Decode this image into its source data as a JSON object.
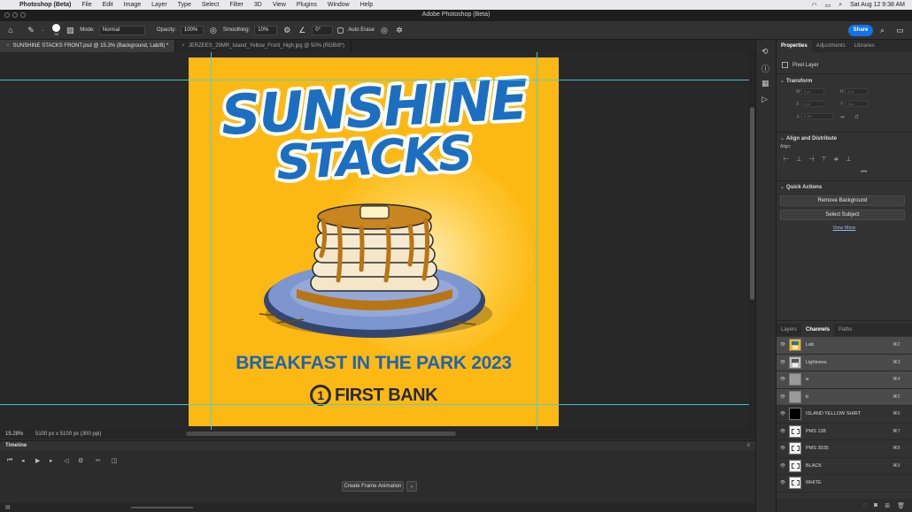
{
  "menubar": {
    "app": "Photoshop (Beta)",
    "items": [
      "File",
      "Edit",
      "Image",
      "Layer",
      "Type",
      "Select",
      "Filter",
      "3D",
      "View",
      "Plugins",
      "Window",
      "Help"
    ],
    "clock": "Sat Aug 12  9:38 AM"
  },
  "titlebar": {
    "title": "Adobe Photoshop (Beta)"
  },
  "options": {
    "brush_size": "90",
    "mode_label": "Mode:",
    "mode_value": "Normal",
    "opacity_label": "Opacity:",
    "opacity_value": "100%",
    "smoothing_label": "Smoothing:",
    "smoothing_value": "10%",
    "angle_value": "0°",
    "auto_erase": "Auto Erase",
    "share": "Share"
  },
  "tabs": [
    {
      "label": "SUNSHINE STACKS FRONT.psd @ 15.3% (Background, Lab/8) *"
    },
    {
      "label": "JERZEES_29MR_Island_Yellow_Front_High.jpg @ 50% (RGB/8*)"
    }
  ],
  "artwork": {
    "title_line1": "SUNSHINE",
    "title_line2": "STACKS",
    "subtitle": "BREAKFAST IN THE PARK 2023",
    "sponsor_num": "1",
    "sponsor": "FIRST BANK",
    "colors": {
      "background": "#fdb913",
      "title": "#1c6fc0",
      "plate": "#6e88c4",
      "syrup": "#b87514"
    }
  },
  "status": {
    "zoom": "15.28%",
    "dimensions": "5100 px x 5100 px (300 ppi)"
  },
  "timeline": {
    "header": "Timeline",
    "create_button": "Create Frame Animation"
  },
  "properties": {
    "tabs": [
      "Properties",
      "Adjustments",
      "Libraries"
    ],
    "layer_type": "Pixel Layer",
    "transform_header": "Transform",
    "w_label": "W",
    "h_label": "H",
    "x_label": "X",
    "y_label": "Y",
    "w_val": "0 px",
    "h_val": "0 px",
    "x_val": "0 px",
    "y_val": "0 px",
    "angle_val": "0.00°",
    "align_header": "Align and Distribute",
    "align_label": "Align:",
    "quick_header": "Quick Actions",
    "remove_bg": "Remove Background",
    "select_subject": "Select Subject",
    "view_more": "View More"
  },
  "channels_panel": {
    "tabs": [
      "Layers",
      "Channels",
      "Paths"
    ],
    "rows": [
      {
        "name": "Lab",
        "shortcut": "⌘2",
        "selected": true,
        "thumb": "color"
      },
      {
        "name": "Lightness",
        "shortcut": "⌘3",
        "selected": true,
        "thumb": "gray"
      },
      {
        "name": "a",
        "shortcut": "⌘4",
        "selected": true,
        "thumb": "flat"
      },
      {
        "name": "b",
        "shortcut": "⌘5",
        "selected": true,
        "thumb": "flat"
      },
      {
        "name": "ISLAND YELLOW SHIRT",
        "shortcut": "⌘6",
        "selected": false,
        "thumb": "black"
      },
      {
        "name": "PMS 138",
        "shortcut": "⌘7",
        "selected": false,
        "thumb": "white"
      },
      {
        "name": "PMS 3035",
        "shortcut": "⌘8",
        "selected": false,
        "thumb": "white"
      },
      {
        "name": "BLACK",
        "shortcut": "⌘9",
        "selected": false,
        "thumb": "white"
      },
      {
        "name": "WHITE",
        "shortcut": "",
        "selected": false,
        "thumb": "white"
      }
    ]
  }
}
